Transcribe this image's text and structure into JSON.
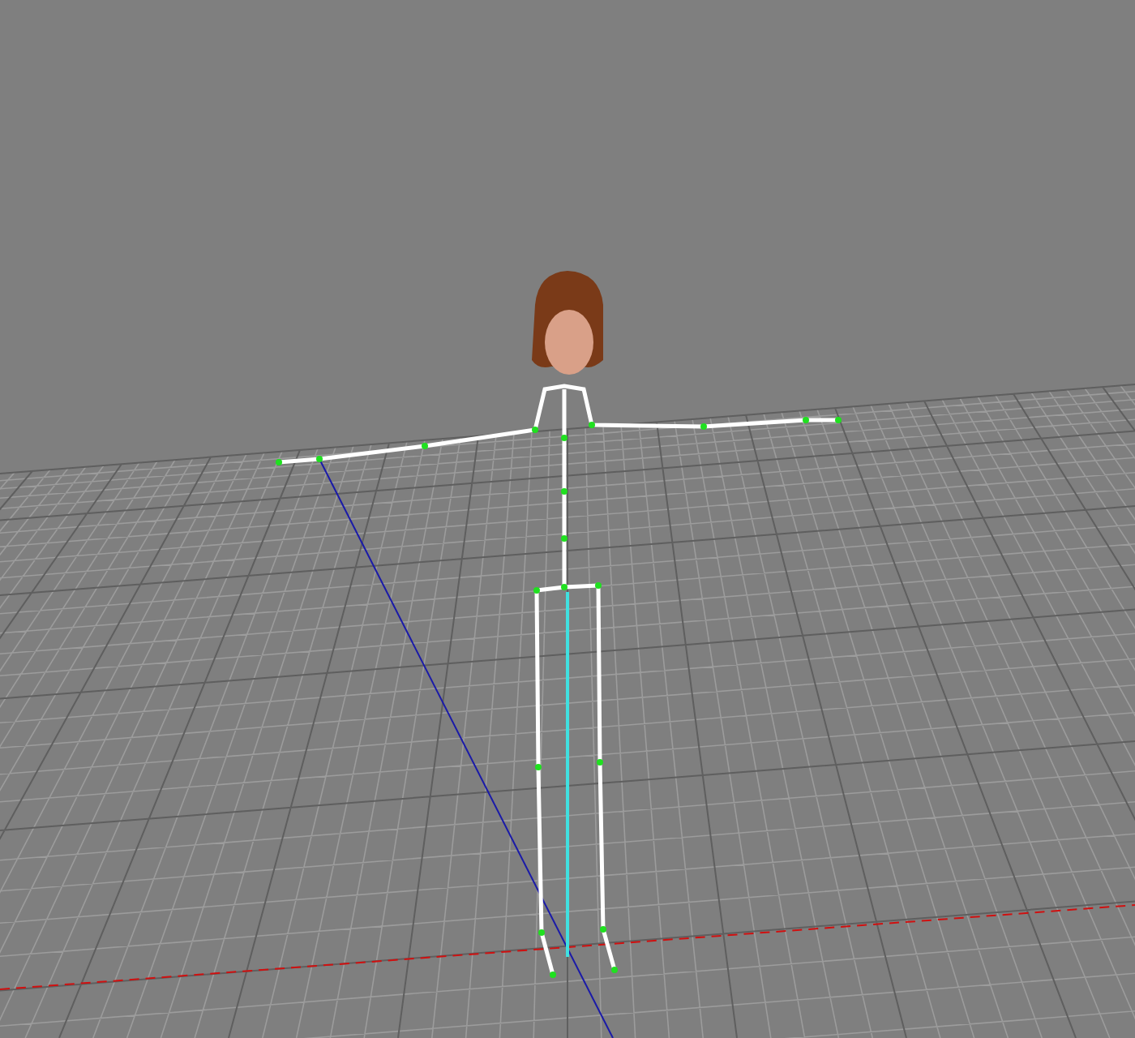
{
  "viewport": {
    "grid_visible": true,
    "skeleton_visible": true
  }
}
